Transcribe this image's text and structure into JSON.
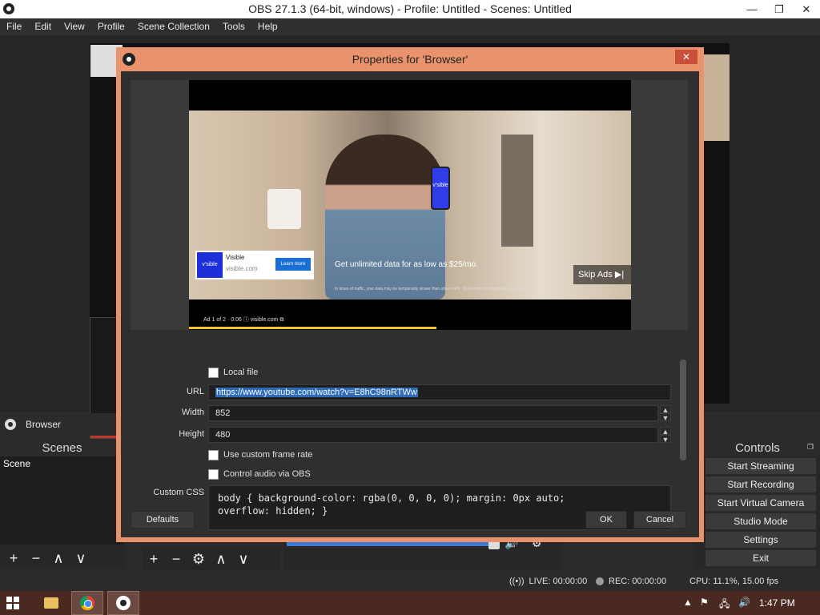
{
  "window": {
    "title": "OBS 27.1.3 (64-bit, windows) - Profile: Untitled - Scenes: Untitled",
    "minimize": "—",
    "restore": "❐",
    "close": "✕"
  },
  "menu": [
    "File",
    "Edit",
    "View",
    "Profile",
    "Scene Collection",
    "Tools",
    "Help"
  ],
  "source_bar": {
    "label": "Browser"
  },
  "scenes_dock": {
    "title": "Scenes",
    "items": [
      "Scene"
    ],
    "toolbar": [
      "+",
      "−",
      "∧",
      "∨"
    ]
  },
  "sources_toolbar": [
    "+",
    "−",
    "⚙",
    "∧",
    "∨"
  ],
  "controls_dock": {
    "title": "Controls",
    "buttons": [
      "Start Streaming",
      "Start Recording",
      "Start Virtual Camera",
      "Studio Mode",
      "Settings",
      "Exit"
    ]
  },
  "status": {
    "live": "LIVE: 00:00:00",
    "rec": "REC: 00:00:00",
    "cpu": "CPU: 11.1%, 15.00 fps"
  },
  "taskbar": {
    "time": "1:47 PM"
  },
  "dialog": {
    "title": "Properties for 'Browser'",
    "close": "✕",
    "video": {
      "brand": "visible",
      "phone_text": "v'sible",
      "ad_logo": "v'sible",
      "ad_name": "Visible",
      "ad_site": "visible.com",
      "ad_cta": "Learn more",
      "tagline": "Get unlimited data for as low as $25/mo.",
      "fine_print": "In times of traffic, your data may be temporarily slower than other traffic. $25/month, for parties of 4 people with Party Pay.",
      "skip": "Skip Ads ▶|",
      "ad_info": "Ad 1 of 2 · 0:06 ⓘ   visible.com ⧉",
      "progress": 0.56
    },
    "local_file_label": "Local file",
    "url_label": "URL",
    "url_value": "https://www.youtube.com/watch?v=E8hC98nRTWw",
    "width_label": "Width",
    "width_value": "852",
    "height_label": "Height",
    "height_value": "480",
    "custom_frame_rate_label": "Use custom frame rate",
    "control_audio_label": "Control audio via OBS",
    "css_label": "Custom CSS",
    "css_value": "body { background-color: rgba(0, 0, 0, 0); margin: 0px auto;\noverflow: hidden; }",
    "defaults_button": "Defaults",
    "ok_button": "OK",
    "cancel_button": "Cancel"
  },
  "colors": {
    "dialog_frame": "#e9926b",
    "taskbar": "#4a2a20",
    "selection": "#2e6bb8"
  }
}
